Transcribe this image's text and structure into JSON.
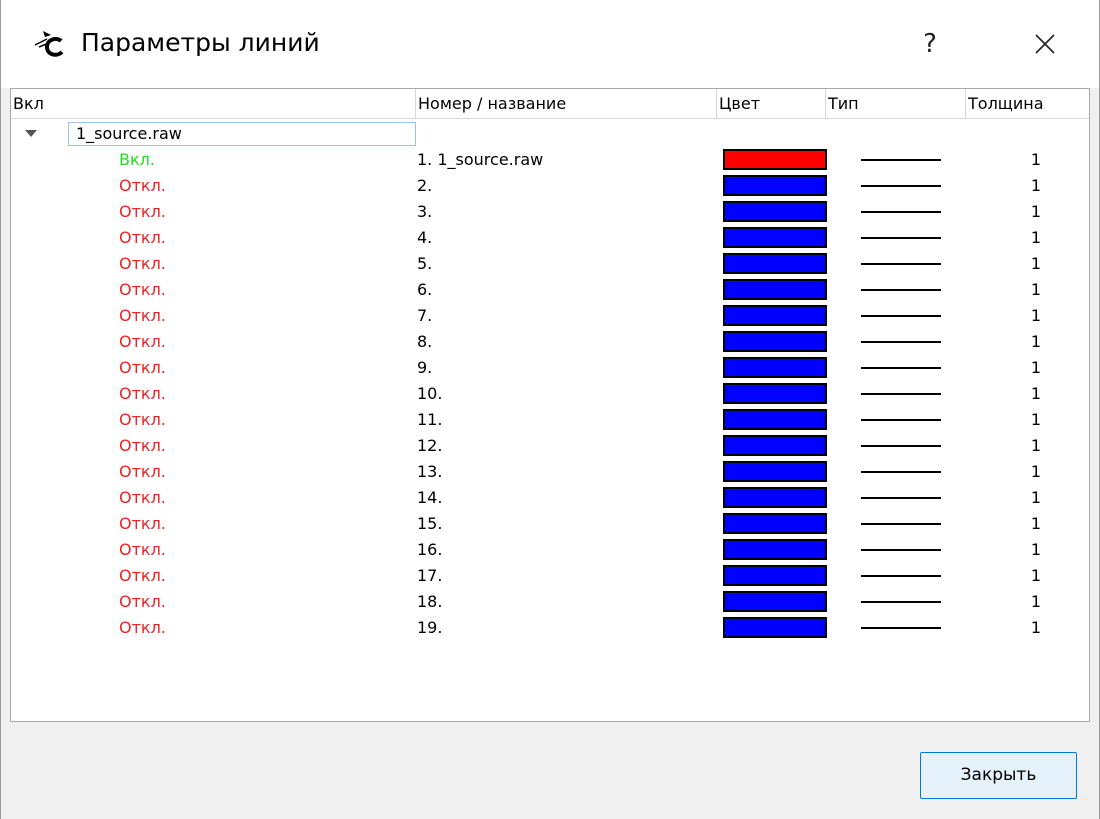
{
  "window": {
    "title": "Параметры линий",
    "help_label": "?",
    "icon": "app-logo-icon",
    "close_icon": "close-icon"
  },
  "columns": [
    "Вкл",
    "Номер / название",
    "Цвет",
    "Тип",
    "Толщина"
  ],
  "tree": {
    "parent_label": "1_source.raw",
    "rows": [
      {
        "status": "Вкл.",
        "on": true,
        "name": "1. 1_source.raw",
        "color": "#ff0000",
        "width": "1"
      },
      {
        "status": "Откл.",
        "on": false,
        "name": "2.",
        "color": "#0000ff",
        "width": "1"
      },
      {
        "status": "Откл.",
        "on": false,
        "name": "3.",
        "color": "#0000ff",
        "width": "1"
      },
      {
        "status": "Откл.",
        "on": false,
        "name": "4.",
        "color": "#0000ff",
        "width": "1"
      },
      {
        "status": "Откл.",
        "on": false,
        "name": "5.",
        "color": "#0000ff",
        "width": "1"
      },
      {
        "status": "Откл.",
        "on": false,
        "name": "6.",
        "color": "#0000ff",
        "width": "1"
      },
      {
        "status": "Откл.",
        "on": false,
        "name": "7.",
        "color": "#0000ff",
        "width": "1"
      },
      {
        "status": "Откл.",
        "on": false,
        "name": "8.",
        "color": "#0000ff",
        "width": "1"
      },
      {
        "status": "Откл.",
        "on": false,
        "name": "9.",
        "color": "#0000ff",
        "width": "1"
      },
      {
        "status": "Откл.",
        "on": false,
        "name": "10.",
        "color": "#0000ff",
        "width": "1"
      },
      {
        "status": "Откл.",
        "on": false,
        "name": "11.",
        "color": "#0000ff",
        "width": "1"
      },
      {
        "status": "Откл.",
        "on": false,
        "name": "12.",
        "color": "#0000ff",
        "width": "1"
      },
      {
        "status": "Откл.",
        "on": false,
        "name": "13.",
        "color": "#0000ff",
        "width": "1"
      },
      {
        "status": "Откл.",
        "on": false,
        "name": "14.",
        "color": "#0000ff",
        "width": "1"
      },
      {
        "status": "Откл.",
        "on": false,
        "name": "15.",
        "color": "#0000ff",
        "width": "1"
      },
      {
        "status": "Откл.",
        "on": false,
        "name": "16.",
        "color": "#0000ff",
        "width": "1"
      },
      {
        "status": "Откл.",
        "on": false,
        "name": "17.",
        "color": "#0000ff",
        "width": "1"
      },
      {
        "status": "Откл.",
        "on": false,
        "name": "18.",
        "color": "#0000ff",
        "width": "1"
      },
      {
        "status": "Откл.",
        "on": false,
        "name": "19.",
        "color": "#0000ff",
        "width": "1"
      }
    ]
  },
  "colors": {
    "on": "#22dd22",
    "off": "#ee2222",
    "accent": "#0078d7"
  },
  "footer": {
    "close_label": "Закрыть"
  }
}
